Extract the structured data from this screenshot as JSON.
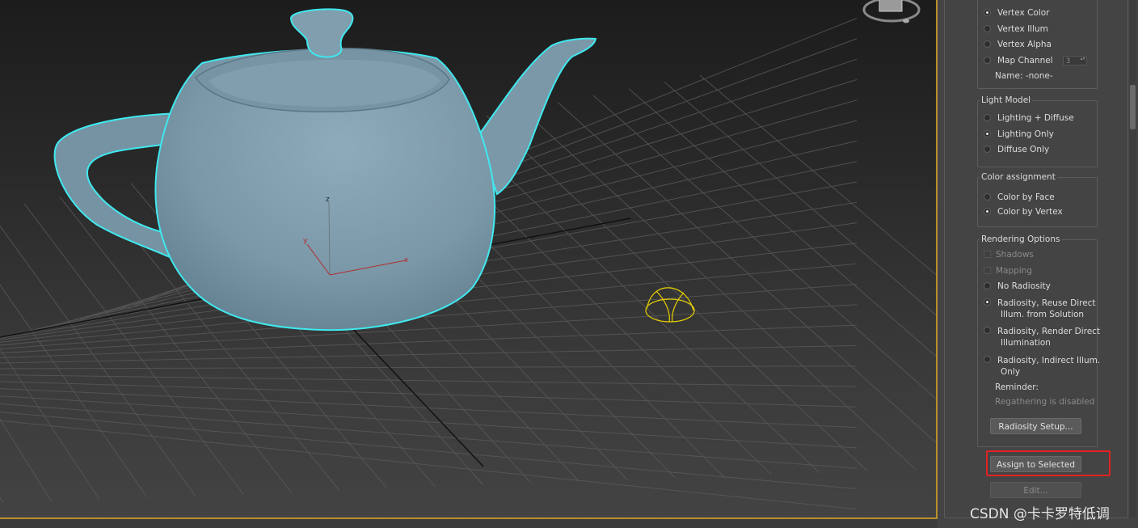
{
  "panel": {
    "vertex_channel": {
      "items": [
        {
          "label": "Vertex Color",
          "checked": true
        },
        {
          "label": "Vertex Illum",
          "checked": false
        },
        {
          "label": "Vertex Alpha",
          "checked": false
        },
        {
          "label": "Map Channel",
          "checked": false
        }
      ],
      "map_channel_value": "3",
      "name_label": "Name: -none-"
    },
    "light_model": {
      "title": "Light Model",
      "items": [
        {
          "label": "Lighting + Diffuse",
          "checked": false
        },
        {
          "label": "Lighting Only",
          "checked": true
        },
        {
          "label": "Diffuse Only",
          "checked": false
        }
      ]
    },
    "color_assignment": {
      "title": "Color assignment",
      "items": [
        {
          "label": "Color by Face",
          "checked": false
        },
        {
          "label": "Color by Vertex",
          "checked": true
        }
      ]
    },
    "rendering_options": {
      "title": "Rendering Options",
      "shadows": "Shadows",
      "mapping": "Mapping",
      "no_radiosity": "No Radiosity",
      "reuse_line1": "Radiosity, Reuse Direct",
      "reuse_line2": "Illum. from Solution",
      "render_line1": "Radiosity, Render Direct",
      "render_line2": "Illumination",
      "indirect_line1": "Radiosity, Indirect Illum.",
      "indirect_line2": "Only",
      "reminder": "Reminder:",
      "regather": "Regathering is disabled",
      "radiosity_setup": "Radiosity Setup...",
      "selected_option": "reuse"
    },
    "assign_button": "Assign to Selected",
    "edit_button": "Edit..."
  },
  "viewport": {
    "axis_labels": {
      "x": "x",
      "y": "y",
      "z": "z"
    },
    "teapot_color": "#7b98a8",
    "selection_outline": "#3fe9ef",
    "light_helper_color": "#e8d000"
  },
  "watermark": "CSDN @卡卡罗特低调"
}
